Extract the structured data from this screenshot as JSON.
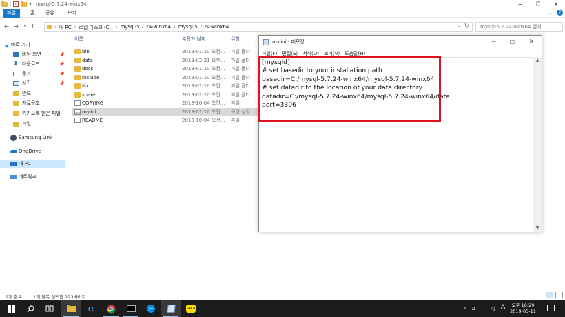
{
  "explorer": {
    "title": "mysql-5.7.24-winx64",
    "ribbon_tabs": [
      "파일",
      "홈",
      "공유",
      "보기"
    ],
    "address": {
      "crumbs": [
        "내 PC",
        "로컬 디스크 (C:)",
        "mysql-5.7.24-winx64",
        "mysql-5.7.24-winx64"
      ],
      "search_placeholder": "mysql-5.7.24-winx64 검색"
    },
    "nav_items": [
      {
        "label": "바로 가기",
        "icon": "star-icon",
        "pinned": false
      },
      {
        "label": "바탕 화면",
        "icon": "desktop-icon",
        "pinned": true
      },
      {
        "label": "다운로드",
        "icon": "download-icon",
        "pinned": true
      },
      {
        "label": "문서",
        "icon": "document-icon",
        "pinned": true
      },
      {
        "label": "사진",
        "icon": "pictures-icon",
        "pinned": true
      },
      {
        "label": "안드",
        "icon": "folder-icon",
        "pinned": false
      },
      {
        "label": "자료구조",
        "icon": "folder-icon",
        "pinned": false
      },
      {
        "label": "카카오톡 받은 파일",
        "icon": "folder-icon",
        "pinned": false
      },
      {
        "label": "파일",
        "icon": "folder-icon",
        "pinned": false
      },
      {
        "label": "Samsung Link",
        "icon": "samsung-link-icon",
        "pinned": false
      },
      {
        "label": "OneDrive",
        "icon": "onedrive-icon",
        "pinned": false
      },
      {
        "label": "내 PC",
        "icon": "pc-icon",
        "pinned": false,
        "selected": true
      },
      {
        "label": "네트워크",
        "icon": "network-icon",
        "pinned": false
      }
    ],
    "columns": {
      "name": "이름",
      "date": "수정한 날짜",
      "type": "유형"
    },
    "files": [
      {
        "name": "bin",
        "date": "2019-01-10 오전...",
        "type": "파일 폴더",
        "kind": "folder"
      },
      {
        "name": "data",
        "date": "2019-02-21 오후...",
        "type": "파일 폴더",
        "kind": "folder"
      },
      {
        "name": "docs",
        "date": "2019-01-10 오전...",
        "type": "파일 폴더",
        "kind": "folder"
      },
      {
        "name": "include",
        "date": "2019-01-10 오전...",
        "type": "파일 폴더",
        "kind": "folder"
      },
      {
        "name": "lib",
        "date": "2019-01-10 오전...",
        "type": "파일 폴더",
        "kind": "folder"
      },
      {
        "name": "share",
        "date": "2019-01-10 오전...",
        "type": "파일 폴더",
        "kind": "folder"
      },
      {
        "name": "COPYING",
        "date": "2018-10-04 오전...",
        "type": "파일",
        "kind": "file"
      },
      {
        "name": "my.ini",
        "date": "2019-01-10 오전...",
        "type": "구성 설정",
        "kind": "ini",
        "selected": true
      },
      {
        "name": "README",
        "date": "2018-10-04 오전...",
        "type": "파일",
        "kind": "file"
      }
    ],
    "status": {
      "count": "9개 항목",
      "selection": "1개 항목 선택함 223바이트"
    }
  },
  "notepad": {
    "title": "my.ini - 메모장",
    "menu": [
      "파일(F)",
      "편집(E)",
      "서식(O)",
      "보기(V)",
      "도움말(H)"
    ],
    "content": "[mysqld]\n# set basedir to your installation path\nbasedir=C:/mysql-5.7.24-winx64/mysql-5.7.24-winx64\n# set datadir to the location of your data directory\ndatadir=C:/mysql-5.7.24-winx64/mysql-5.7.24-winx64/data\nport=3306"
  },
  "taskbar": {
    "apps": [
      "start-icon",
      "search-icon",
      "task-view-icon",
      "file-explorer-icon",
      "edge-icon",
      "chrome-icon",
      "terminal-icon",
      "teamviewer-icon",
      "notepad-icon",
      "kakaotalk-icon"
    ],
    "ime": "A",
    "time": "오후 10:29",
    "date": "2019-03-11"
  },
  "colors": {
    "accent": "#1979ca",
    "highlight_box": "#e0141e",
    "taskbar": "#1c1c1c",
    "folder": "#e8b83e"
  }
}
